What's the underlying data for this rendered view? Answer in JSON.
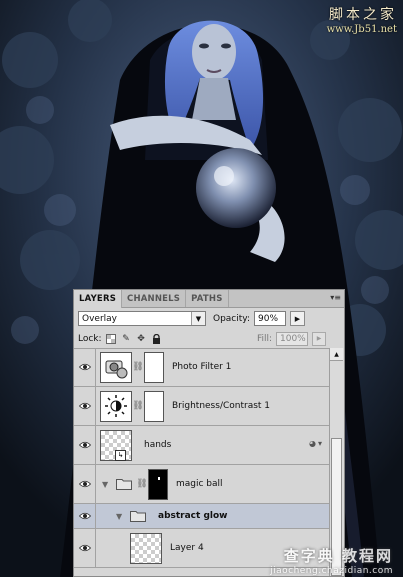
{
  "watermark_top": {
    "text": "脚本之家",
    "url": "www.Jb51.net"
  },
  "watermark_bottom": {
    "text": "查字典 教程网",
    "url": "jiaocheng.chazidian.com"
  },
  "panel": {
    "tabs": [
      {
        "label": "LAYERS",
        "active": true
      },
      {
        "label": "CHANNELS",
        "active": false
      },
      {
        "label": "PATHS",
        "active": false
      }
    ],
    "blend_mode": "Overlay",
    "opacity_label": "Opacity:",
    "opacity_value": "90%",
    "lock_label": "Lock:",
    "fill_label": "Fill:",
    "fill_value": "100%",
    "layers": [
      {
        "name": "Photo Filter 1",
        "type": "adjustment",
        "thumb_icon": "photo-filter-icon"
      },
      {
        "name": "Brightness/Contrast 1",
        "type": "adjustment",
        "thumb_icon": "brightness-contrast-icon"
      },
      {
        "name": "hands",
        "type": "smart-object",
        "has_effects": true
      },
      {
        "name": "magic ball",
        "type": "group",
        "expanded": true
      },
      {
        "name": "abstract glow",
        "type": "group",
        "expanded": true,
        "selected": true
      },
      {
        "name": "Layer 4",
        "type": "pixel"
      }
    ]
  },
  "colors": {
    "panel_bg": "#d6d6d6",
    "selected_row": "#c1c8d6",
    "scene_bg": "#10141d"
  }
}
